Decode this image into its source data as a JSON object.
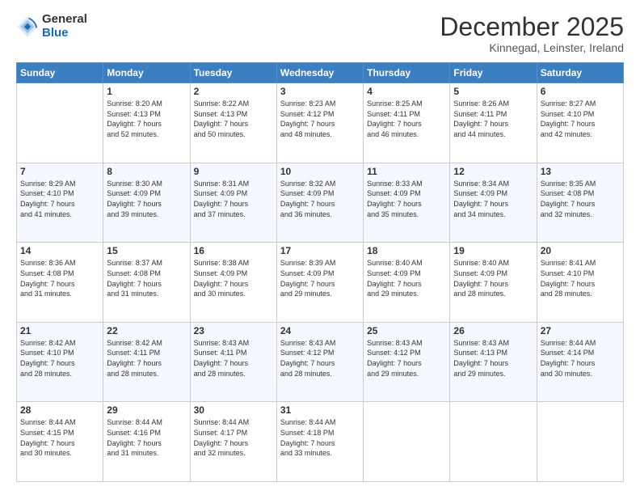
{
  "logo": {
    "general": "General",
    "blue": "Blue"
  },
  "header": {
    "month": "December 2025",
    "location": "Kinnegad, Leinster, Ireland"
  },
  "weekdays": [
    "Sunday",
    "Monday",
    "Tuesday",
    "Wednesday",
    "Thursday",
    "Friday",
    "Saturday"
  ],
  "weeks": [
    [
      {
        "day": "",
        "info": ""
      },
      {
        "day": "1",
        "info": "Sunrise: 8:20 AM\nSunset: 4:13 PM\nDaylight: 7 hours\nand 52 minutes."
      },
      {
        "day": "2",
        "info": "Sunrise: 8:22 AM\nSunset: 4:13 PM\nDaylight: 7 hours\nand 50 minutes."
      },
      {
        "day": "3",
        "info": "Sunrise: 8:23 AM\nSunset: 4:12 PM\nDaylight: 7 hours\nand 48 minutes."
      },
      {
        "day": "4",
        "info": "Sunrise: 8:25 AM\nSunset: 4:11 PM\nDaylight: 7 hours\nand 46 minutes."
      },
      {
        "day": "5",
        "info": "Sunrise: 8:26 AM\nSunset: 4:11 PM\nDaylight: 7 hours\nand 44 minutes."
      },
      {
        "day": "6",
        "info": "Sunrise: 8:27 AM\nSunset: 4:10 PM\nDaylight: 7 hours\nand 42 minutes."
      }
    ],
    [
      {
        "day": "7",
        "info": "Sunrise: 8:29 AM\nSunset: 4:10 PM\nDaylight: 7 hours\nand 41 minutes."
      },
      {
        "day": "8",
        "info": "Sunrise: 8:30 AM\nSunset: 4:09 PM\nDaylight: 7 hours\nand 39 minutes."
      },
      {
        "day": "9",
        "info": "Sunrise: 8:31 AM\nSunset: 4:09 PM\nDaylight: 7 hours\nand 37 minutes."
      },
      {
        "day": "10",
        "info": "Sunrise: 8:32 AM\nSunset: 4:09 PM\nDaylight: 7 hours\nand 36 minutes."
      },
      {
        "day": "11",
        "info": "Sunrise: 8:33 AM\nSunset: 4:09 PM\nDaylight: 7 hours\nand 35 minutes."
      },
      {
        "day": "12",
        "info": "Sunrise: 8:34 AM\nSunset: 4:09 PM\nDaylight: 7 hours\nand 34 minutes."
      },
      {
        "day": "13",
        "info": "Sunrise: 8:35 AM\nSunset: 4:08 PM\nDaylight: 7 hours\nand 32 minutes."
      }
    ],
    [
      {
        "day": "14",
        "info": "Sunrise: 8:36 AM\nSunset: 4:08 PM\nDaylight: 7 hours\nand 31 minutes."
      },
      {
        "day": "15",
        "info": "Sunrise: 8:37 AM\nSunset: 4:08 PM\nDaylight: 7 hours\nand 31 minutes."
      },
      {
        "day": "16",
        "info": "Sunrise: 8:38 AM\nSunset: 4:09 PM\nDaylight: 7 hours\nand 30 minutes."
      },
      {
        "day": "17",
        "info": "Sunrise: 8:39 AM\nSunset: 4:09 PM\nDaylight: 7 hours\nand 29 minutes."
      },
      {
        "day": "18",
        "info": "Sunrise: 8:40 AM\nSunset: 4:09 PM\nDaylight: 7 hours\nand 29 minutes."
      },
      {
        "day": "19",
        "info": "Sunrise: 8:40 AM\nSunset: 4:09 PM\nDaylight: 7 hours\nand 28 minutes."
      },
      {
        "day": "20",
        "info": "Sunrise: 8:41 AM\nSunset: 4:10 PM\nDaylight: 7 hours\nand 28 minutes."
      }
    ],
    [
      {
        "day": "21",
        "info": "Sunrise: 8:42 AM\nSunset: 4:10 PM\nDaylight: 7 hours\nand 28 minutes."
      },
      {
        "day": "22",
        "info": "Sunrise: 8:42 AM\nSunset: 4:11 PM\nDaylight: 7 hours\nand 28 minutes."
      },
      {
        "day": "23",
        "info": "Sunrise: 8:43 AM\nSunset: 4:11 PM\nDaylight: 7 hours\nand 28 minutes."
      },
      {
        "day": "24",
        "info": "Sunrise: 8:43 AM\nSunset: 4:12 PM\nDaylight: 7 hours\nand 28 minutes."
      },
      {
        "day": "25",
        "info": "Sunrise: 8:43 AM\nSunset: 4:12 PM\nDaylight: 7 hours\nand 29 minutes."
      },
      {
        "day": "26",
        "info": "Sunrise: 8:43 AM\nSunset: 4:13 PM\nDaylight: 7 hours\nand 29 minutes."
      },
      {
        "day": "27",
        "info": "Sunrise: 8:44 AM\nSunset: 4:14 PM\nDaylight: 7 hours\nand 30 minutes."
      }
    ],
    [
      {
        "day": "28",
        "info": "Sunrise: 8:44 AM\nSunset: 4:15 PM\nDaylight: 7 hours\nand 30 minutes."
      },
      {
        "day": "29",
        "info": "Sunrise: 8:44 AM\nSunset: 4:16 PM\nDaylight: 7 hours\nand 31 minutes."
      },
      {
        "day": "30",
        "info": "Sunrise: 8:44 AM\nSunset: 4:17 PM\nDaylight: 7 hours\nand 32 minutes."
      },
      {
        "day": "31",
        "info": "Sunrise: 8:44 AM\nSunset: 4:18 PM\nDaylight: 7 hours\nand 33 minutes."
      },
      {
        "day": "",
        "info": ""
      },
      {
        "day": "",
        "info": ""
      },
      {
        "day": "",
        "info": ""
      }
    ]
  ]
}
